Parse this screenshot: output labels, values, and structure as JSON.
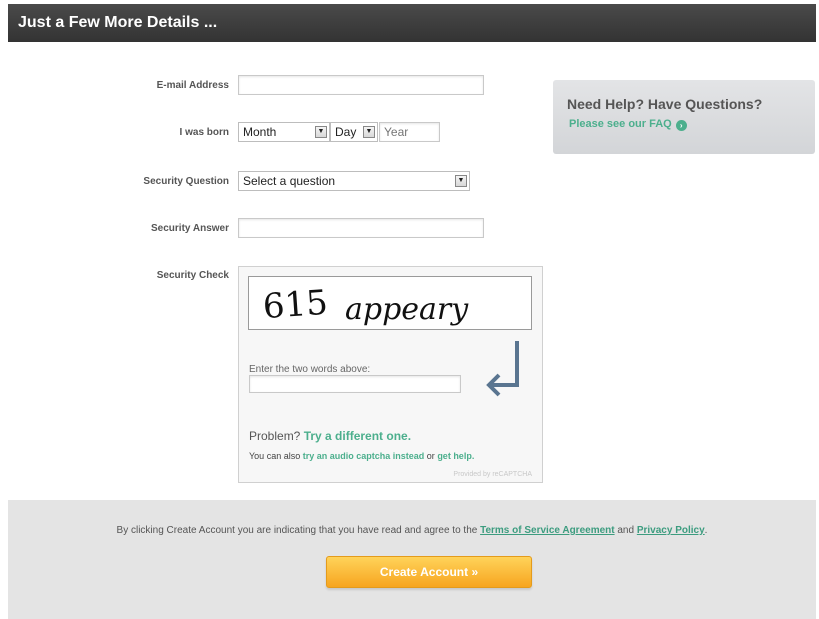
{
  "header": {
    "title": "Just a Few More Details ..."
  },
  "form": {
    "email_label": "E-mail Address",
    "email_value": "",
    "born_label": "I was born",
    "month_value": "Month",
    "day_value": "Day",
    "year_value": "Year",
    "security_question_label": "Security Question",
    "security_question_value": "Select a question",
    "security_answer_label": "Security Answer",
    "security_answer_value": "",
    "security_check_label": "Security Check"
  },
  "help": {
    "title": "Need Help? Have Questions?",
    "link": "Please see our FAQ"
  },
  "captcha": {
    "word1": "615",
    "word2": "appeary",
    "prompt": "Enter the two words above:",
    "input_value": "",
    "problem_text": "Problem?",
    "problem_link": "Try a different one.",
    "alt_prefix": "You can also",
    "alt_audio_link": "try an audio captcha instead",
    "alt_or": "or",
    "alt_help_link": "get help.",
    "provided_by": "Provided by reCAPTCHA"
  },
  "footer": {
    "legal_prefix": "By clicking Create Account you are indicating that you have read and agree to the",
    "terms_link": "Terms of Service Agreement",
    "and": "and",
    "privacy_link": "Privacy Policy",
    "period": ".",
    "create_button": "Create Account »"
  },
  "icons": {
    "select_arrow": "triangle-down-icon",
    "help_go": "arrow-circle-right-icon",
    "captcha_return": "return-arrow-icon"
  },
  "colors": {
    "header_bg": "#3b3b3b",
    "link_green": "#4caf8d",
    "button_orange": "#f7a51f",
    "footer_bg": "#e4e4e4"
  }
}
